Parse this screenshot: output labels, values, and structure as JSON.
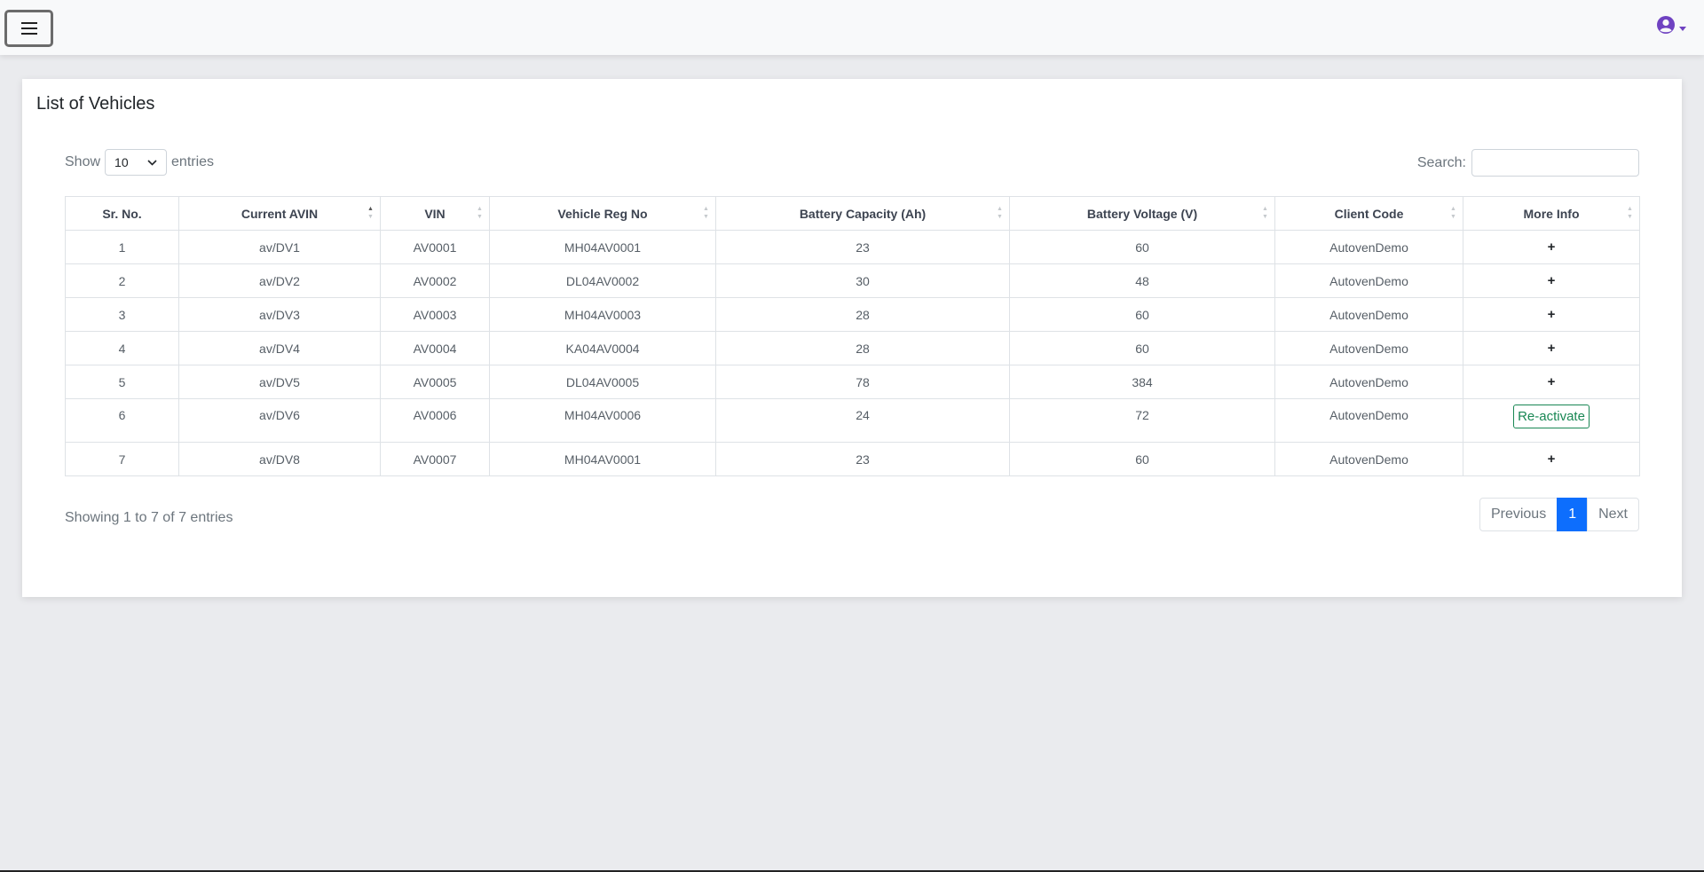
{
  "header": {
    "menu_icon": "hamburger-icon",
    "user_icon": "user-circle-icon",
    "accent_color": "#6f42c1"
  },
  "card": {
    "title": "List of Vehicles"
  },
  "controls": {
    "show_label": "Show",
    "entries_value": "10",
    "entries_label": "entries",
    "search_label": "Search:",
    "search_value": ""
  },
  "table": {
    "columns": [
      "Sr. No.",
      "Current AVIN",
      "VIN",
      "Vehicle Reg No",
      "Battery Capacity (Ah)",
      "Battery Voltage (V)",
      "Client Code",
      "More Info"
    ],
    "rows": [
      {
        "sr": "1",
        "avin": "av/DV1",
        "vin": "AV0001",
        "reg": "MH04AV0001",
        "capacity": "23",
        "voltage": "60",
        "client": "AutovenDemo",
        "more": "+"
      },
      {
        "sr": "2",
        "avin": "av/DV2",
        "vin": "AV0002",
        "reg": "DL04AV0002",
        "capacity": "30",
        "voltage": "48",
        "client": "AutovenDemo",
        "more": "+"
      },
      {
        "sr": "3",
        "avin": "av/DV3",
        "vin": "AV0003",
        "reg": "MH04AV0003",
        "capacity": "28",
        "voltage": "60",
        "client": "AutovenDemo",
        "more": "+"
      },
      {
        "sr": "4",
        "avin": "av/DV4",
        "vin": "AV0004",
        "reg": "KA04AV0004",
        "capacity": "28",
        "voltage": "60",
        "client": "AutovenDemo",
        "more": "+"
      },
      {
        "sr": "5",
        "avin": "av/DV5",
        "vin": "AV0005",
        "reg": "DL04AV0005",
        "capacity": "78",
        "voltage": "384",
        "client": "AutovenDemo",
        "more": "+"
      },
      {
        "sr": "6",
        "avin": "av/DV6",
        "vin": "AV0006",
        "reg": "MH04AV0006",
        "capacity": "24",
        "voltage": "72",
        "client": "AutovenDemo",
        "more": "Re-activate"
      },
      {
        "sr": "7",
        "avin": "av/DV8",
        "vin": "AV0007",
        "reg": "MH04AV0001",
        "capacity": "23",
        "voltage": "60",
        "client": "AutovenDemo",
        "more": "+"
      }
    ]
  },
  "footer": {
    "info": "Showing 1 to 7 of 7 entries",
    "previous": "Previous",
    "current_page": "1",
    "next": "Next"
  },
  "colors": {
    "page_active": "#0d6efd",
    "reactivate": "#198754"
  }
}
